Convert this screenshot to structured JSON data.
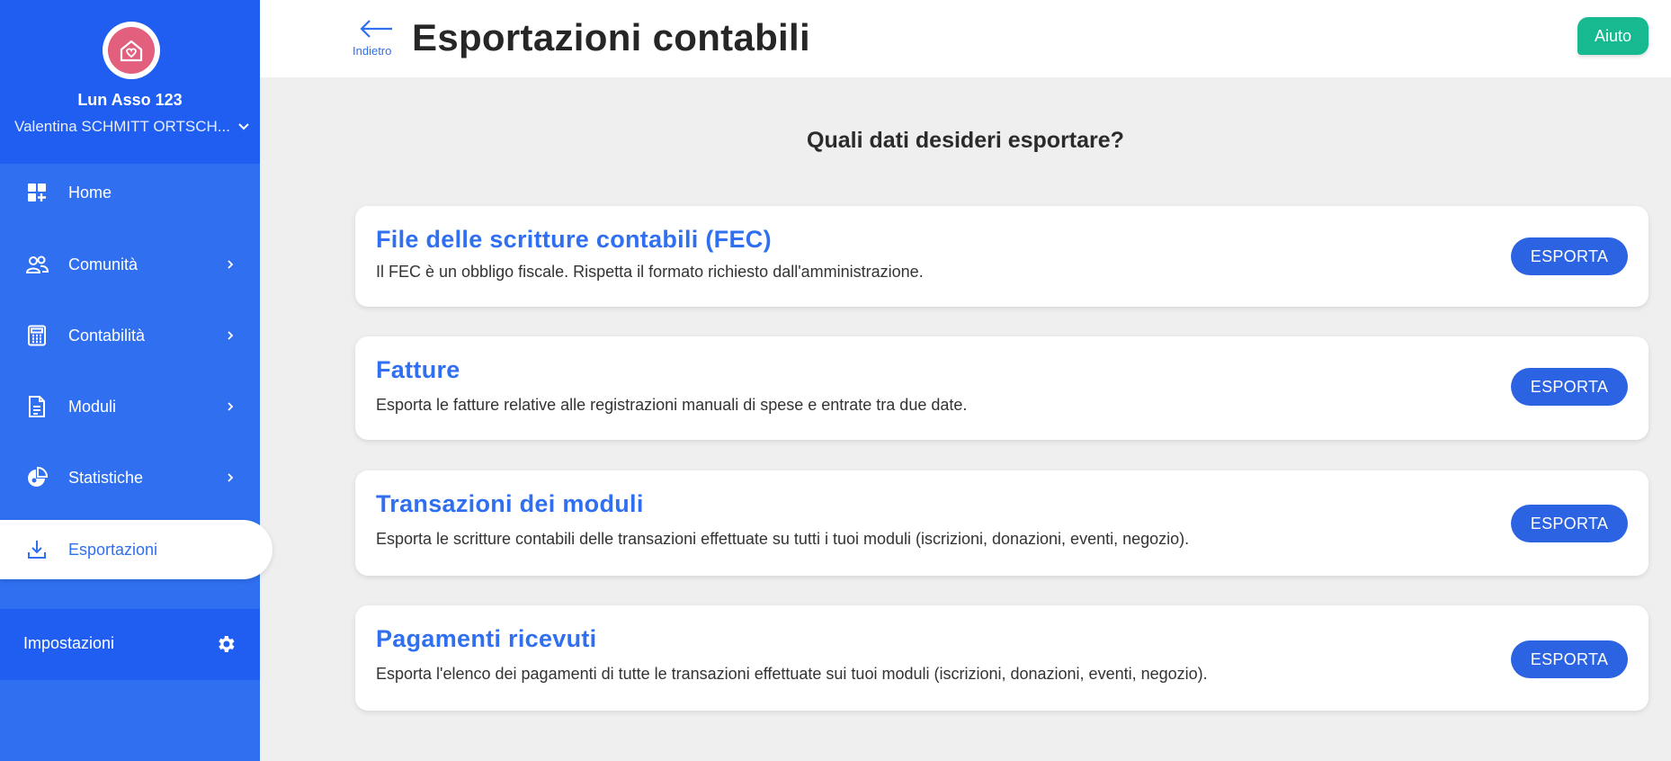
{
  "sidebar": {
    "org_name": "Lun Asso 123",
    "user_name": "Valentina SCHMITT ORTSCH...",
    "items": [
      {
        "label": "Home",
        "icon": "dashboard-icon"
      },
      {
        "label": "Comunità",
        "icon": "users-icon"
      },
      {
        "label": "Contabilità",
        "icon": "calculator-icon"
      },
      {
        "label": "Moduli",
        "icon": "document-icon"
      },
      {
        "label": "Statistiche",
        "icon": "pie-chart-icon"
      },
      {
        "label": "Esportazioni",
        "icon": "download-icon"
      }
    ],
    "settings_label": "Impostazioni"
  },
  "header": {
    "back_label": "Indietro",
    "title": "Esportazioni contabili",
    "help_label": "Aiuto"
  },
  "main": {
    "question": "Quali dati desideri esportare?",
    "cards": [
      {
        "title": "File delle scritture contabili (FEC)",
        "description": "Il FEC è un obbligo fiscale. Rispetta il formato richiesto dall'amministrazione.",
        "button": "ESPORTA"
      },
      {
        "title": "Fatture",
        "description": "Esporta le fatture relative alle registrazioni manuali di spese e entrate tra due date.",
        "button": "ESPORTA"
      },
      {
        "title": "Transazioni dei moduli",
        "description": "Esporta le scritture contabili delle transazioni effettuate su tutti i tuoi moduli (iscrizioni, donazioni, eventi, negozio).",
        "button": "ESPORTA"
      },
      {
        "title": "Pagamenti ricevuti",
        "description": "Esporta l'elenco dei pagamenti di tutte le transazioni effettuate sui tuoi moduli (iscrizioni, donazioni, eventi, negozio).",
        "button": "ESPORTA"
      }
    ]
  },
  "colors": {
    "sidebar": "#2f6ff0",
    "sidebar_dark": "#1f5ef0",
    "accent": "#2f6ff0",
    "help_button": "#16b990",
    "logo": "#e35f7e"
  }
}
